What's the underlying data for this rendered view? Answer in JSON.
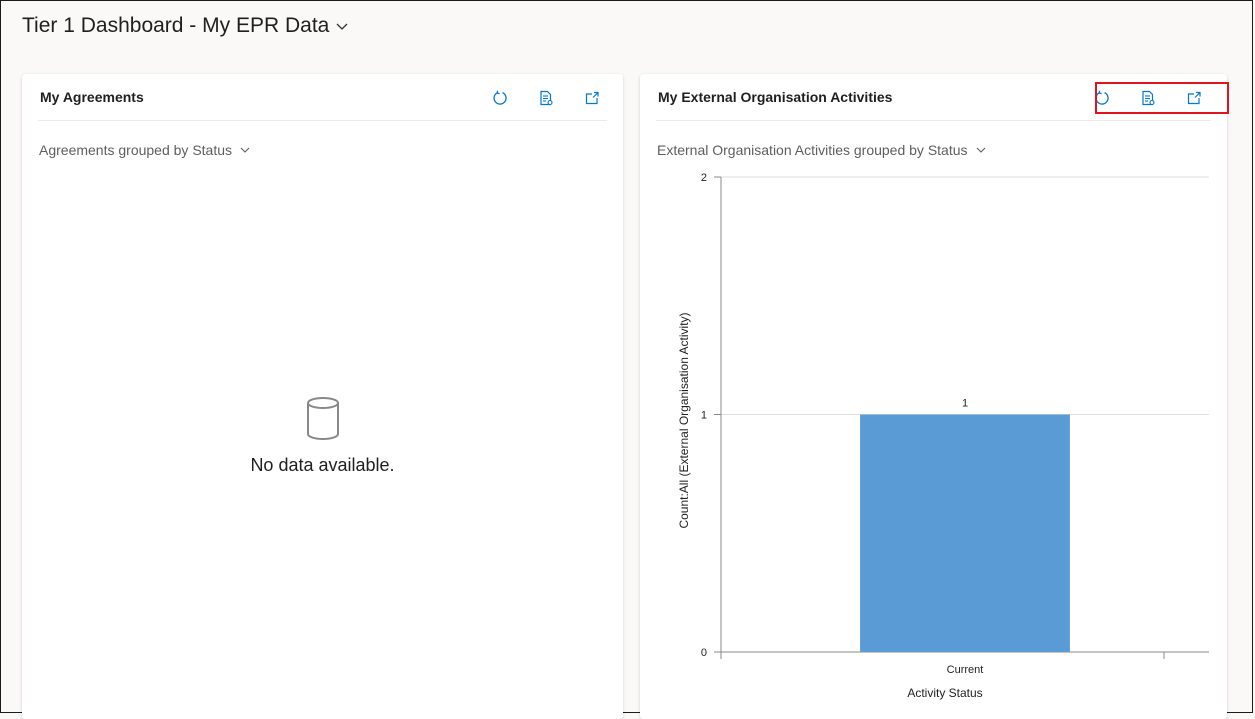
{
  "dashboard": {
    "title": "Tier 1 Dashboard - My EPR Data"
  },
  "left_card": {
    "title": "My Agreements",
    "view": "Agreements grouped by Status",
    "empty_message": "No data available.",
    "actions": [
      "refresh-icon",
      "view-records-icon",
      "expand-icon"
    ]
  },
  "right_card": {
    "title": "My External Organisation Activities",
    "view": "External Organisation Activities grouped by Status",
    "actions": [
      "refresh-icon",
      "view-records-icon",
      "expand-icon"
    ]
  },
  "colors": {
    "accent": "#0078d4",
    "bar": "#5b9bd5",
    "highlight": "#e0141e"
  },
  "chart_data": {
    "type": "bar",
    "categories": [
      "Current"
    ],
    "values": [
      1
    ],
    "data_labels": [
      "1"
    ],
    "xlabel": "Activity Status",
    "ylabel": "Count:All (External Organisation Activity)",
    "yticks": [
      0,
      1,
      2
    ],
    "ylim": [
      0,
      2
    ],
    "grid": true
  }
}
